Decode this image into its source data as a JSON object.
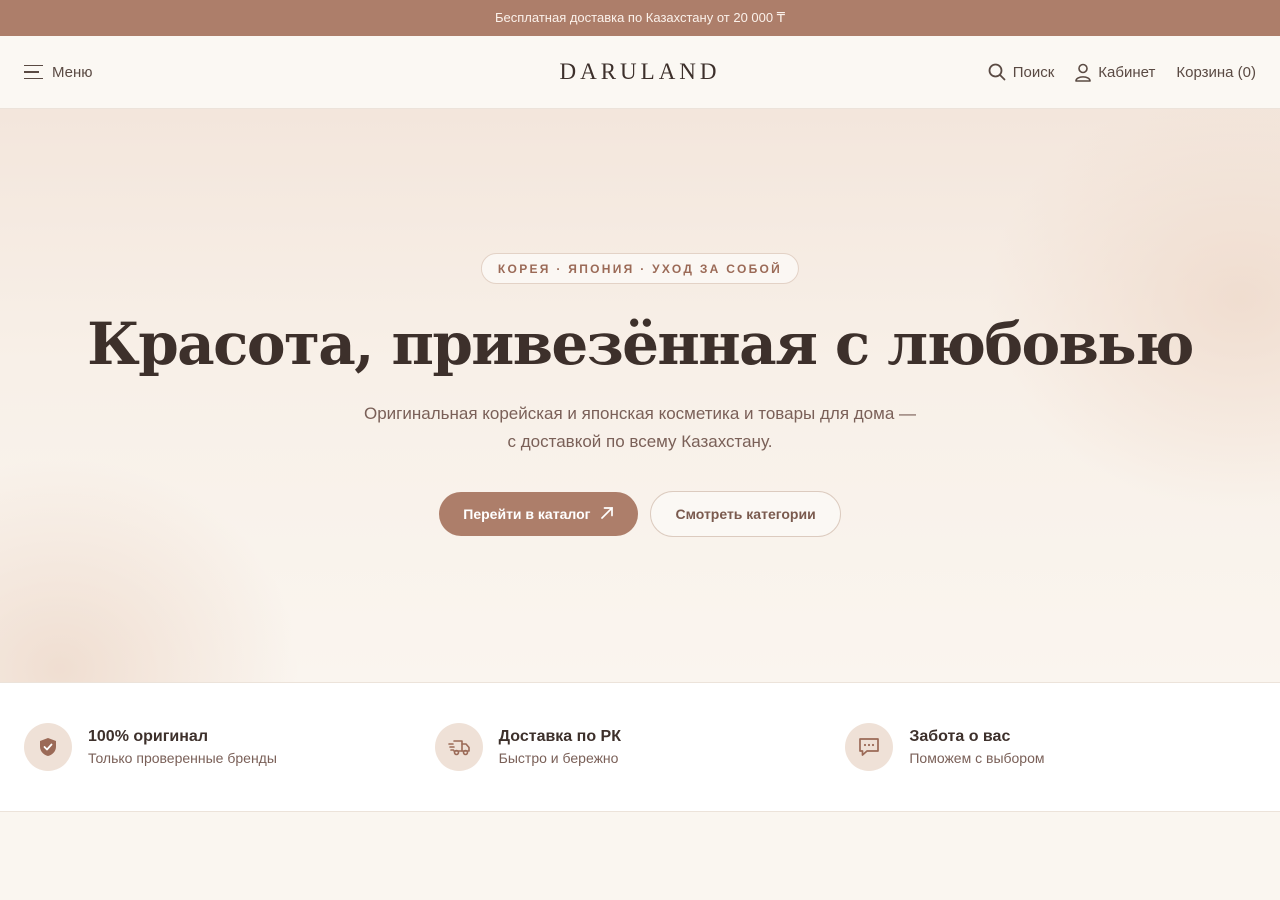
{
  "topbar": {
    "text": "Бесплатная доставка по Казахстану от 20 000 ₸"
  },
  "header": {
    "menu_label": "Меню",
    "logo": "DARULAND",
    "search_label": "Поиск",
    "account_label": "Кабинет",
    "cart_label": "Корзина (0)"
  },
  "hero": {
    "eyebrow": "КОРЕЯ · ЯПОНИЯ · УХОД ЗА СОБОЙ",
    "title": "Красота, привезённая с любовью",
    "subtitle": "Оригинальная корейская и японская косметика и товары для дома — с доставкой по всему Казахстану.",
    "primary_button": "Перейти в каталог",
    "secondary_button": "Смотреть категории"
  },
  "features": [
    {
      "title": "100% оригинал",
      "desc": "Только проверенные бренды",
      "icon": "shield-check-icon"
    },
    {
      "title": "Доставка по РК",
      "desc": "Быстро и бережно",
      "icon": "delivery-truck-icon"
    },
    {
      "title": "Забота о вас",
      "desc": "Поможем с выбором",
      "icon": "chat-bubble-icon"
    }
  ],
  "colors": {
    "accent": "#ad7e6a",
    "background": "#faf6f0",
    "text": "#3d302b",
    "muted": "#7a6058"
  }
}
